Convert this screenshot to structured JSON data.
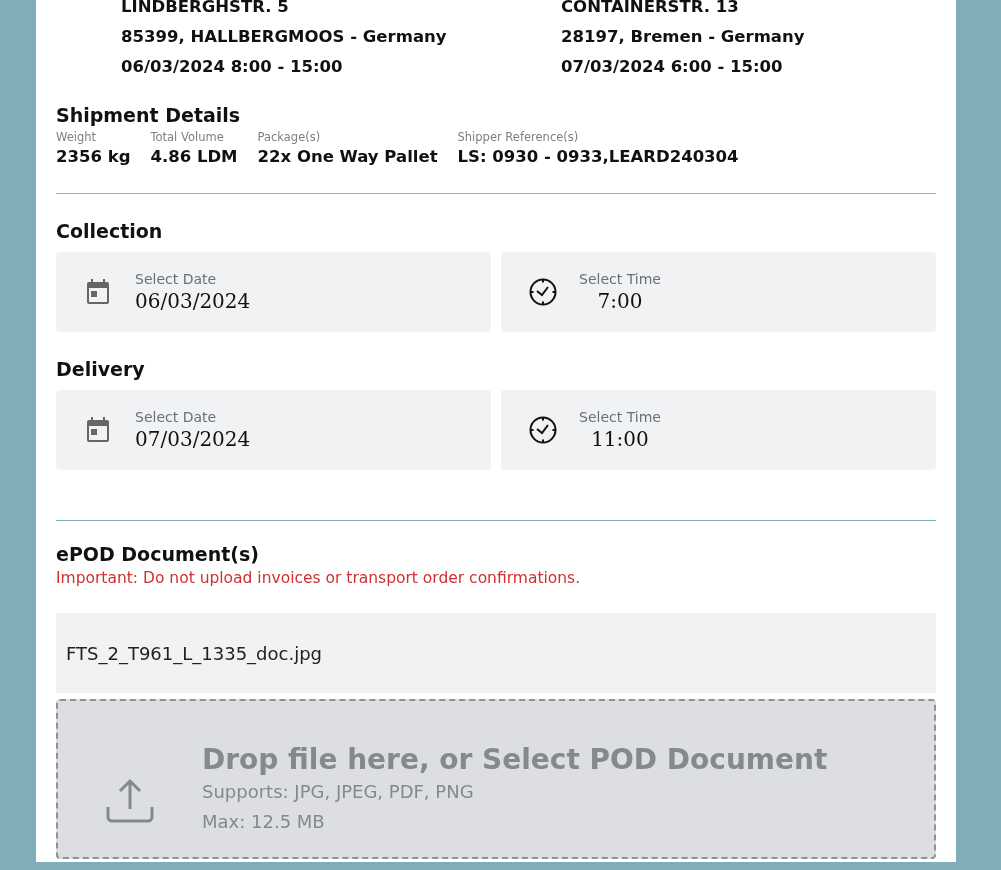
{
  "addresses": [
    {
      "lines": [
        "LINDBERGHSTR. 5",
        "85399, HALLBERGMOOS - Germany",
        "06/03/2024 8:00 - 15:00"
      ]
    },
    {
      "lines": [
        "CONTAINERSTR. 13",
        "28197, Bremen - Germany",
        "07/03/2024 6:00 - 15:00"
      ]
    }
  ],
  "shipment_details": {
    "title": "Shipment Details",
    "items": [
      {
        "label": "Weight",
        "value": "2356 kg"
      },
      {
        "label": "Total Volume",
        "value": "4.86 LDM"
      },
      {
        "label": "Package(s)",
        "value": "22x One Way Pallet"
      },
      {
        "label": "Shipper Reference(s)",
        "value": "LS: 0930 - 0933,LEARD240304"
      }
    ]
  },
  "sections": [
    {
      "title": "Collection",
      "fields": [
        {
          "kind": "date",
          "label": "Select Date",
          "value": "06/03/2024"
        },
        {
          "kind": "time",
          "label": "Select Time",
          "value": "7:00"
        }
      ]
    },
    {
      "title": "Delivery",
      "fields": [
        {
          "kind": "date",
          "label": "Select Date",
          "value": "07/03/2024"
        },
        {
          "kind": "time",
          "label": "Select Time",
          "value": "11:00"
        }
      ]
    }
  ],
  "epod": {
    "title": "ePOD Document(s)",
    "warning": "Important: Do not upload invoices or transport order confirmations.",
    "files": [
      "FTS_2_T961_L_1335_doc.jpg"
    ],
    "dropzone": {
      "title": "Drop file here, or Select POD Document",
      "supports": "Supports: JPG, JPEG, PDF, PNG",
      "max": "Max: 12.5 MB"
    }
  }
}
